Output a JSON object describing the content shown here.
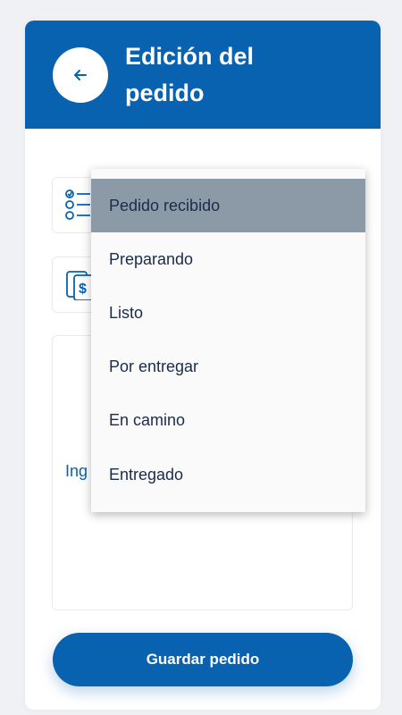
{
  "header": {
    "title": "Edición del\npedido",
    "back_icon": "arrow-left-icon"
  },
  "form": {
    "status_icon": "checklist-icon",
    "payment_icon": "money-bill-icon",
    "notes_placeholder": "Ing"
  },
  "status_dropdown": {
    "options": [
      {
        "label": "Pedido recibido",
        "selected": true
      },
      {
        "label": "Preparando",
        "selected": false
      },
      {
        "label": "Listo",
        "selected": false
      },
      {
        "label": "Por entregar",
        "selected": false
      },
      {
        "label": "En camino",
        "selected": false
      },
      {
        "label": "Entregado",
        "selected": false
      }
    ]
  },
  "footer": {
    "save_label": "Guardar pedido"
  },
  "colors": {
    "primary": "#0862af",
    "selected_option": "#8c9aa7",
    "option_text": "#1c2b4a"
  }
}
